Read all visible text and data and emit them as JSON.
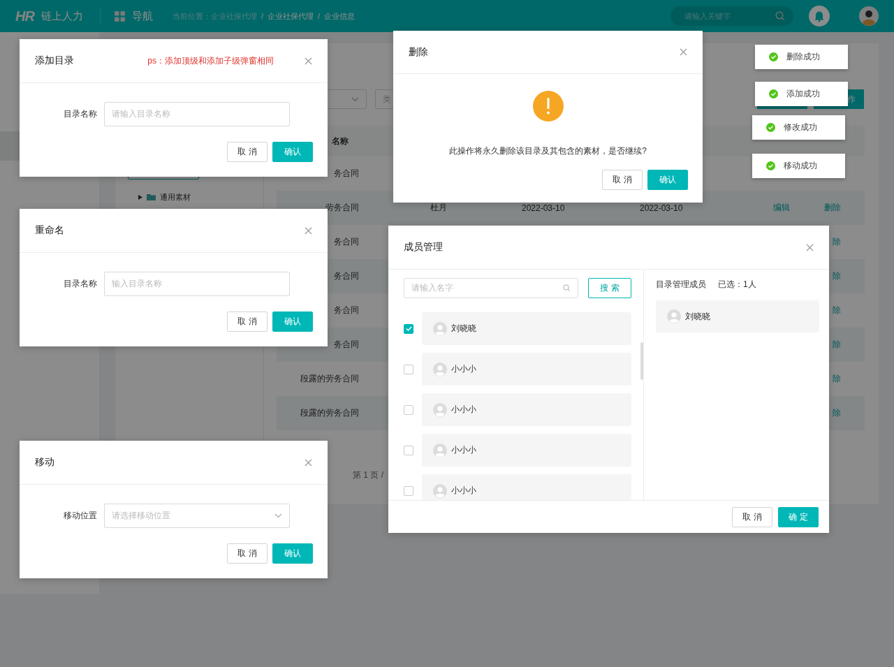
{
  "header": {
    "logo_mark": "HR",
    "brand": "链上人力",
    "nav": "导航",
    "breadcrumb": [
      {
        "text": "当前位置：企业社保代理",
        "kind": "muted"
      },
      {
        "text": "/",
        "kind": "sep"
      },
      {
        "text": "企业社保代理",
        "kind": "link"
      },
      {
        "text": "/",
        "kind": "sep"
      },
      {
        "text": "企业信息",
        "kind": "link"
      }
    ],
    "search": {
      "placeholder": "请输入关键字"
    }
  },
  "sidebar": {
    "items": [
      {
        "selected": true
      }
    ]
  },
  "tree": {
    "items": [
      {
        "selected": true
      },
      {
        "label": "通用素材",
        "selected": false,
        "expanded": false
      }
    ]
  },
  "filters": [
    {
      "kind": "select"
    },
    {
      "kind": "text",
      "label": "类"
    }
  ],
  "actions": [
    {
      "kind": "button"
    },
    {
      "kind": "button",
      "label": "作"
    }
  ],
  "table": {
    "header": {
      "name": "名称"
    },
    "rows": [
      {
        "name": "务合同"
      },
      {
        "name": "劳务合同",
        "creator": "杜月",
        "created": "2022-03-10",
        "updated": "2022-03-10",
        "edit": "编辑",
        "delete": "删除"
      },
      {
        "name": "务合同",
        "delete": "除"
      },
      {
        "name": "务合同",
        "delete": "除"
      },
      {
        "name": "务合同",
        "delete": "除"
      },
      {
        "name": "务合同",
        "delete": "除"
      },
      {
        "name": "段露的劳务合同",
        "delete": "除"
      },
      {
        "name": "段露的劳务合同",
        "delete": "除"
      }
    ]
  },
  "pagination": "第 1 页 /",
  "dialogs": [
    {
      "kind": "form",
      "title": "添加目录",
      "note": "ps：添加顶级和添加子级弹窗相同",
      "field": {
        "kind": "input",
        "label": "目录名称",
        "placeholder": "请输入目录名称"
      },
      "buttons": [
        {
          "label": "取 消",
          "kind": "secondary"
        },
        {
          "label": "确认",
          "kind": "primary"
        }
      ]
    },
    {
      "kind": "form",
      "title": "重命名",
      "field": {
        "kind": "input",
        "label": "目录名称",
        "placeholder": "输入目录名称"
      },
      "buttons": [
        {
          "label": "取 消",
          "kind": "secondary"
        },
        {
          "label": "确认",
          "kind": "primary"
        }
      ]
    },
    {
      "kind": "form",
      "title": "移动",
      "field": {
        "kind": "select",
        "label": "移动位置",
        "placeholder": "请选择移动位置"
      },
      "buttons": [
        {
          "label": "取 消",
          "kind": "secondary"
        },
        {
          "label": "确认",
          "kind": "primary"
        }
      ]
    },
    {
      "kind": "confirm",
      "title": "删除",
      "message": "此操作将永久删除该目录及其包含的素材，是否继续?",
      "buttons": [
        {
          "label": "取 消",
          "kind": "secondary"
        },
        {
          "label": "确认",
          "kind": "primary"
        }
      ]
    },
    {
      "kind": "members",
      "title": "成员管理",
      "search": {
        "placeholder": "请输入名字"
      },
      "search_button": "搜 索",
      "members": [
        {
          "name": "刘晓晓",
          "checked": true
        },
        {
          "name": "小小小",
          "checked": false
        },
        {
          "name": "小小小",
          "checked": false
        },
        {
          "name": "小小小",
          "checked": false
        },
        {
          "name": "小小小",
          "checked": false
        }
      ],
      "selected_title": "目录管理成员",
      "selected_count": "已选：1人",
      "selected_members": [
        {
          "name": "刘晓晓"
        }
      ],
      "buttons": [
        {
          "label": "取 消",
          "kind": "secondary"
        },
        {
          "label": "确 定",
          "kind": "primary"
        }
      ]
    }
  ],
  "toasts": [
    {
      "text": "删除成功"
    },
    {
      "text": "添加成功"
    },
    {
      "text": "修改成功"
    },
    {
      "text": "移动成功"
    }
  ]
}
